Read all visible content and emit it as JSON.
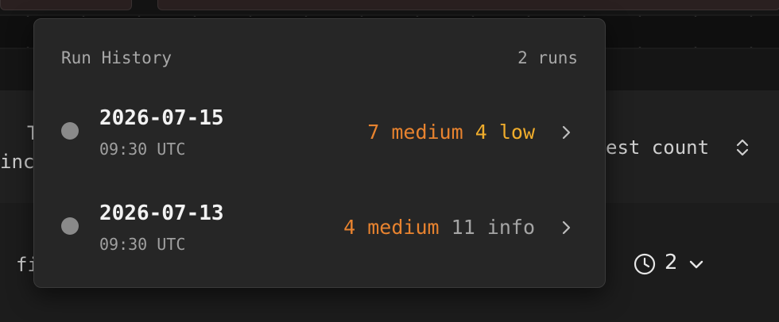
{
  "background": {
    "left_col_label_1": "T",
    "left_col_label_2": "inc",
    "right_col_label": "est count",
    "row_label": "fi",
    "history_count": "2"
  },
  "run_history": {
    "title": "Run History",
    "count_label": "2 runs",
    "runs": [
      {
        "date": "2026-07-15",
        "time": "09:30 UTC",
        "sev_a": "7 medium",
        "sev_b": "4 low"
      },
      {
        "date": "2026-07-13",
        "time": "09:30 UTC",
        "sev_a": "4 medium",
        "sev_b": "11 info"
      }
    ]
  },
  "colors": {
    "medium": "#e8832f",
    "low": "#f0ad2c",
    "info": "#a5a5a5",
    "status_dot": "#8a8a8a"
  },
  "icons": {
    "row_chevron": "chevron-right-icon",
    "sort": "sort-updown-icon",
    "history": "clock-icon",
    "dropdown": "chevron-down-icon"
  }
}
